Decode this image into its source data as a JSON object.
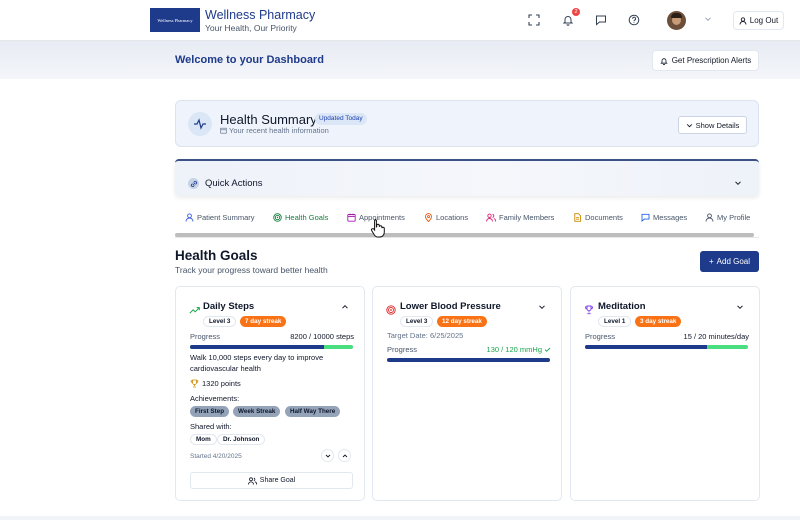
{
  "header": {
    "logo_text": "Wellness Pharmacy",
    "brand_name": "Wellness Pharmacy",
    "tagline": "Your Health, Our Priority",
    "notification_count": "2",
    "logout_label": "Log Out"
  },
  "welcome": {
    "title": "Welcome to your Dashboard",
    "alerts_button": "Get Prescription Alerts"
  },
  "summary": {
    "title": "Health Summary",
    "badge": "Updated Today",
    "subtitle": "Your recent health information",
    "show_details": "Show Details"
  },
  "quick_actions": {
    "title": "Quick Actions"
  },
  "tabs": [
    {
      "label": "Patient Summary"
    },
    {
      "label": "Health Goals"
    },
    {
      "label": "Appointments"
    },
    {
      "label": "Locations"
    },
    {
      "label": "Family Members"
    },
    {
      "label": "Documents"
    },
    {
      "label": "Messages"
    },
    {
      "label": "My Profile"
    }
  ],
  "goals_section": {
    "title": "Health Goals",
    "subtitle": "Track your progress toward better health",
    "add_button": "Add Goal"
  },
  "goals": [
    {
      "title": "Daily Steps",
      "level": "Level 3",
      "streak": "7 day streak",
      "progress_label": "Progress",
      "progress_value": "8200 / 10000 steps",
      "progress_fraction": 0.82,
      "description": "Walk 10,000 steps every day to improve cardiovascular health",
      "points": "1320 points",
      "achievements_title": "Achievements:",
      "achievements": [
        "First Step",
        "Week Streak",
        "Half Way There"
      ],
      "shared_title": "Shared with:",
      "shared_with": [
        "Mom",
        "Dr. Johnson"
      ],
      "started": "Started 4/20/2025",
      "share_button": "Share Goal"
    },
    {
      "title": "Lower Blood Pressure",
      "level": "Level 3",
      "streak": "12 day streak",
      "target_date": "Target Date: 6/25/2025",
      "progress_label": "Progress",
      "progress_value": "130 / 120 mmHg",
      "progress_fraction": 1.0
    },
    {
      "title": "Meditation",
      "level": "Level 1",
      "streak": "3 day streak",
      "progress_label": "Progress",
      "progress_value": "15 / 20 minutes/day",
      "progress_fraction": 0.75
    }
  ],
  "colors": {
    "brand": "#1e3a8a",
    "streak": "#f97316",
    "success": "#16a34a",
    "progress_fill": "#1e3a8a",
    "progress_track": "#4ade80"
  }
}
